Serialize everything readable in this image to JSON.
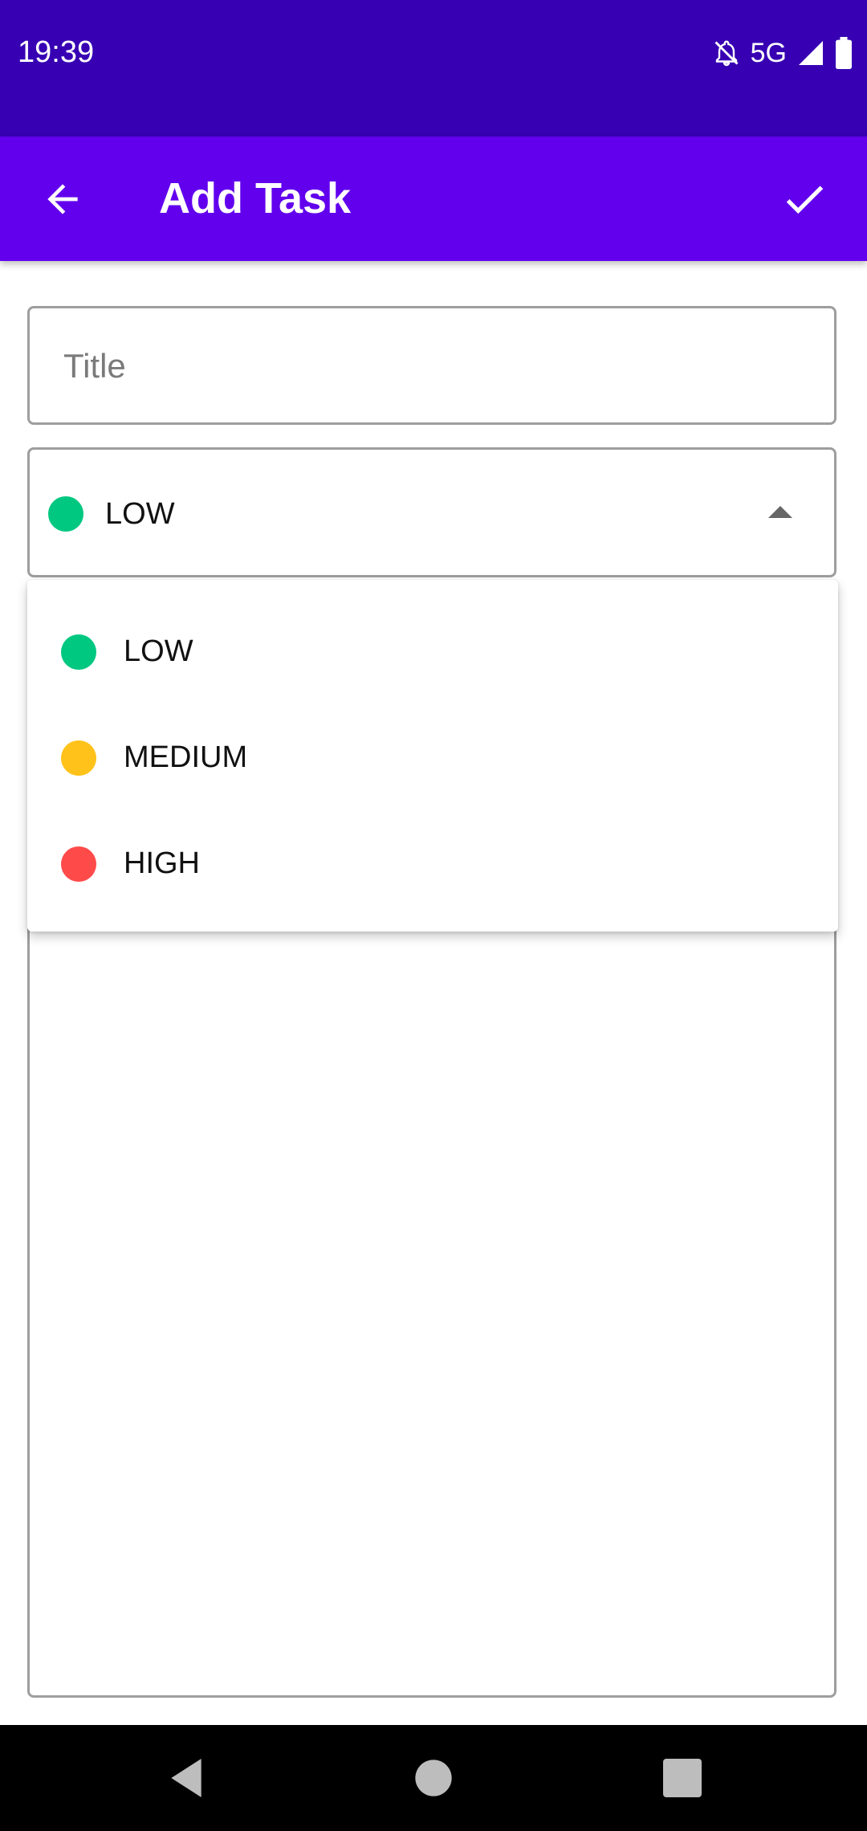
{
  "status_bar": {
    "time": "19:39",
    "network": "5G"
  },
  "app_bar": {
    "title": "Add Task",
    "back_icon": "arrow-back-icon",
    "save_icon": "check-icon"
  },
  "title_field": {
    "placeholder": "Title",
    "value": ""
  },
  "priority": {
    "selected": {
      "label": "LOW",
      "color": "#00c880"
    },
    "options": [
      {
        "label": "LOW",
        "color": "#00c880"
      },
      {
        "label": "MEDIUM",
        "color": "#ffc21a"
      },
      {
        "label": "HIGH",
        "color": "#ff4a4a"
      }
    ]
  },
  "description_field": {
    "value": ""
  },
  "colors": {
    "status_bar": "#3700b3",
    "app_bar": "#6200ee",
    "nav_bar": "#000000"
  }
}
